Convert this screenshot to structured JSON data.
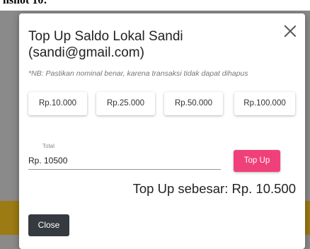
{
  "page": {
    "caption": "nshot 10:"
  },
  "modal": {
    "title": "Top Up Saldo Lokal Sandi (sandi@gmail.com)",
    "note": "*NB: Pastikan nominal benar, karena transaksi tidak dapat dihapus",
    "amount_buttons": [
      {
        "label": "Rp.10.000"
      },
      {
        "label": "Rp.25.000"
      },
      {
        "label": "Rp.50.000"
      },
      {
        "label": "Rp.100.000"
      }
    ],
    "total_field": {
      "label": "Total",
      "value": "Rp. 10500"
    },
    "topup_label": "Top Up",
    "summary": "Top Up sebesar: Rp. 10.500",
    "close_label": "Close"
  },
  "colors": {
    "topup_button": "#f0407a",
    "close_button": "#343a40",
    "backdrop": "#8a8a8a"
  }
}
